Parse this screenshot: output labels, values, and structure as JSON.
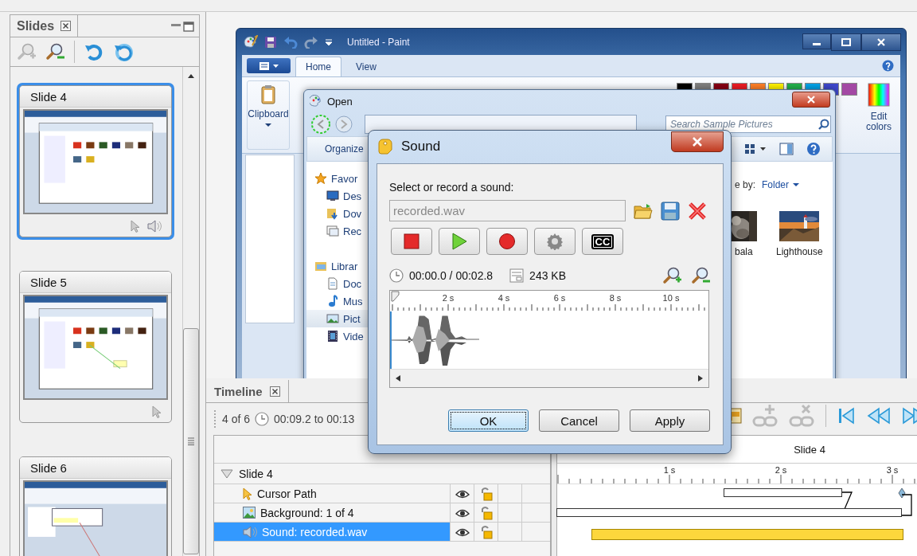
{
  "slides_panel": {
    "title": "Slides",
    "slides": [
      {
        "title": "Slide 4",
        "selected": true,
        "cursor": true,
        "sound": true
      },
      {
        "title": "Slide 5",
        "selected": false,
        "cursor": true,
        "sound": false
      },
      {
        "title": "Slide 6",
        "selected": false
      }
    ]
  },
  "paint": {
    "title": "Untitled - Paint",
    "tabs": [
      {
        "label": "Home",
        "selected": true
      },
      {
        "label": "View",
        "selected": false
      }
    ],
    "clipboard": "Clipboard",
    "edit_colors": "Edit colors",
    "palette": [
      {
        "color": "#000000"
      },
      {
        "color": "#7f7f7f"
      },
      {
        "color": "#880015"
      },
      {
        "color": "#ed1c24"
      },
      {
        "color": "#ff7f27"
      },
      {
        "color": "#fff200"
      },
      {
        "color": "#22b14c"
      },
      {
        "color": "#00a2e8"
      },
      {
        "color": "#3f48cc"
      },
      {
        "color": "#a349a4"
      }
    ]
  },
  "open_dialog": {
    "title": "Open",
    "search": {
      "placeholder": "Search Sample Pictures"
    },
    "organize": "Organize",
    "sort_label": "e by:",
    "sort_value": "Folder",
    "nav": [
      {
        "label": "Favor",
        "kind": "favorites",
        "selected": false,
        "children": [
          {
            "label": "Des",
            "kind": "desktop",
            "selected": false
          },
          {
            "label": "Dov",
            "kind": "downloads",
            "selected": false
          },
          {
            "label": "Rec",
            "kind": "recent",
            "selected": false
          }
        ]
      },
      {
        "label": "Librar",
        "kind": "libraries",
        "selected": false,
        "children": [
          {
            "label": "Doc",
            "kind": "documents",
            "selected": false
          },
          {
            "label": "Mus",
            "kind": "music",
            "selected": false
          },
          {
            "label": "Pict",
            "kind": "pictures",
            "selected": true
          },
          {
            "label": "Vide",
            "kind": "videos",
            "selected": false
          }
        ]
      }
    ],
    "thumbnails": [
      {
        "label": "bala",
        "kind": "picture"
      },
      {
        "label": "Lighthouse",
        "kind": "picture"
      }
    ]
  },
  "sound_dialog": {
    "title": "Sound",
    "prompt": "Select or record a sound:",
    "file": {
      "value": "recorded.wav",
      "disabled": true
    },
    "captions_label": "CC",
    "position": "00:00.0 / 00:02.8",
    "size": "243 KB",
    "ruler": [
      "2 s",
      "4 s",
      "6 s",
      "8 s",
      "10 s"
    ],
    "buttons": [
      {
        "label": "OK",
        "default": true
      },
      {
        "label": "Cancel",
        "default": false
      },
      {
        "label": "Apply",
        "default": false
      }
    ]
  },
  "timeline": {
    "title": "Timeline",
    "counter": "4 of 6",
    "range": "00:09.2 to 00:13",
    "track_header": "Slide 4",
    "ruler": [
      "1 s",
      "2 s",
      "3 s"
    ],
    "rows": [
      {
        "label": "Slide 4",
        "kind": "slide",
        "expanded": true,
        "children": [
          {
            "label": "Cursor Path",
            "kind": "cursor",
            "selected": false
          },
          {
            "label": "Background: 1 of 4",
            "kind": "background",
            "selected": false
          },
          {
            "label": "Sound: recorded.wav",
            "kind": "sound",
            "selected": true
          }
        ]
      }
    ]
  }
}
